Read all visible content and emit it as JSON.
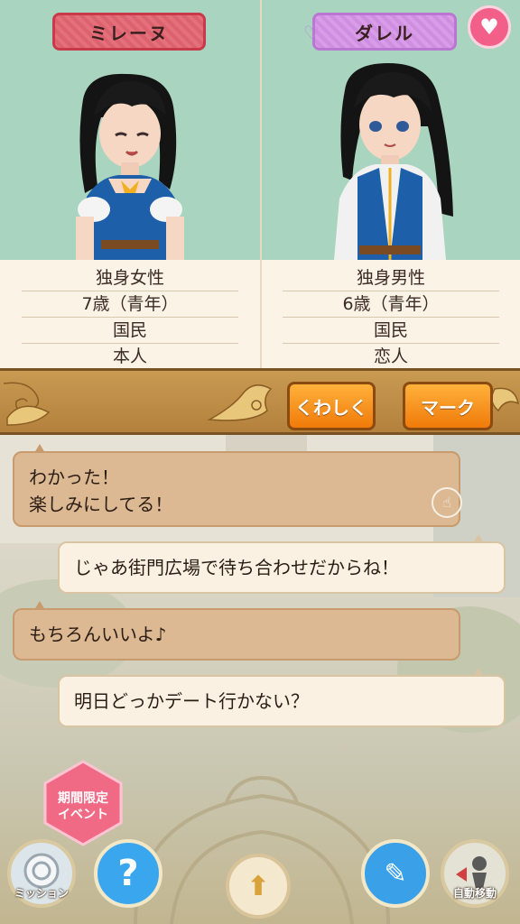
{
  "left_character": {
    "name": "ミレーヌ",
    "info": [
      "独身女性",
      "7歳（青年）",
      "国民",
      "本人"
    ]
  },
  "right_character": {
    "name": "ダレル",
    "info": [
      "独身男性",
      "6歳（青年）",
      "国民",
      "恋人"
    ],
    "heart_icon": "heart-icon"
  },
  "actions": {
    "detail_label": "くわしく",
    "mark_label": "マーク"
  },
  "messages": [
    {
      "side": "left",
      "lines": [
        "わかった！",
        "楽しみにしてる！"
      ]
    },
    {
      "side": "right",
      "lines": [
        "じゃあ街門広場で待ち合わせだからね！"
      ]
    },
    {
      "side": "left",
      "lines": [
        "もちろんいいよ♪"
      ]
    },
    {
      "side": "right",
      "lines": [
        "明日どっかデート行かない？"
      ]
    }
  ],
  "bottom_nav": {
    "event_line1": "期間限定",
    "event_line2": "イベント",
    "mission_label": "ミッション",
    "help_glyph": "?",
    "auto_move_label": "自動移動"
  },
  "colors": {
    "portrait_bg": "#a9d4c0",
    "left_tag": "#e4707a",
    "right_tag": "#d99ce8",
    "orange_button": "#f58c1a",
    "heart": "#f2608a"
  }
}
